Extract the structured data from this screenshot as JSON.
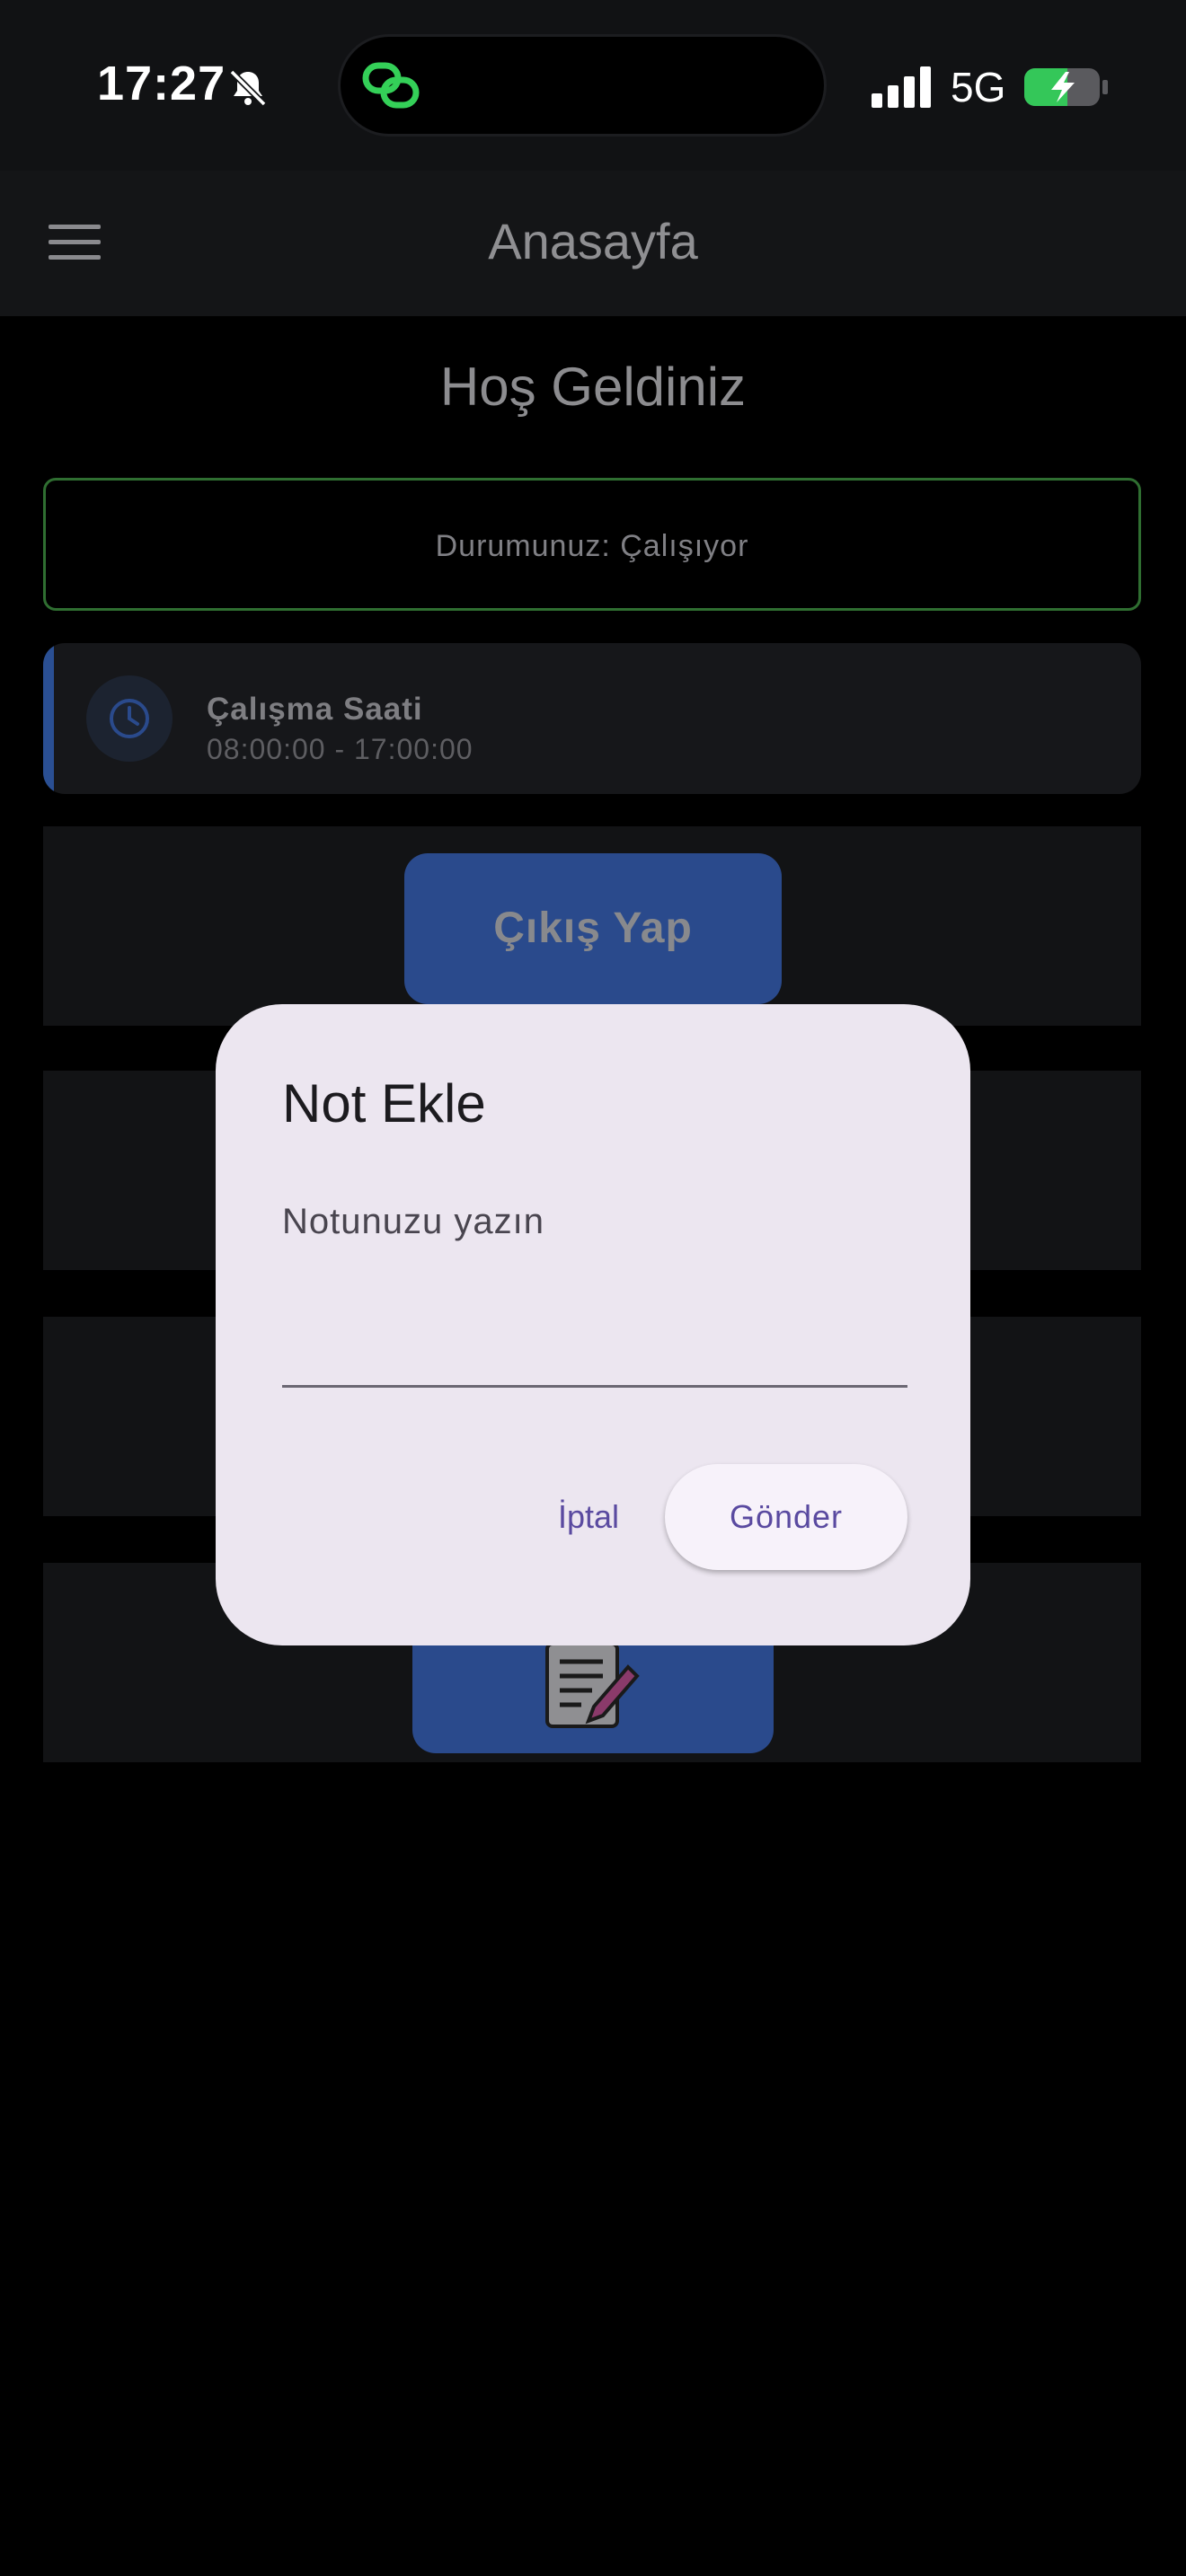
{
  "status_bar": {
    "time": "17:27",
    "network": "5G",
    "icons": [
      "bell-slash-icon",
      "link-icon",
      "signal-icon",
      "battery-charging-icon"
    ]
  },
  "app_bar": {
    "title": "Anasayfa",
    "menu_icon": "hamburger-menu-icon"
  },
  "main": {
    "welcome": "Hoş Geldiniz",
    "status_text": "Durumunuz: Çalışıyor",
    "work_hours": {
      "label": "Çalışma Saati",
      "value": "08:00:00 - 17:00:00",
      "icon": "clock-icon"
    },
    "exit_button": "Çıkış Yap",
    "note_button_icon": "note-edit-icon"
  },
  "dialog": {
    "title": "Not Ekle",
    "placeholder": "Notunuzu yazın",
    "cancel": "İptal",
    "send": "Gönder"
  },
  "colors": {
    "accent_blue": "#2a4a8c",
    "status_green": "#2f6e31",
    "dialog_bg": "#ece6f0",
    "dialog_button_text": "#5a4aa0"
  }
}
